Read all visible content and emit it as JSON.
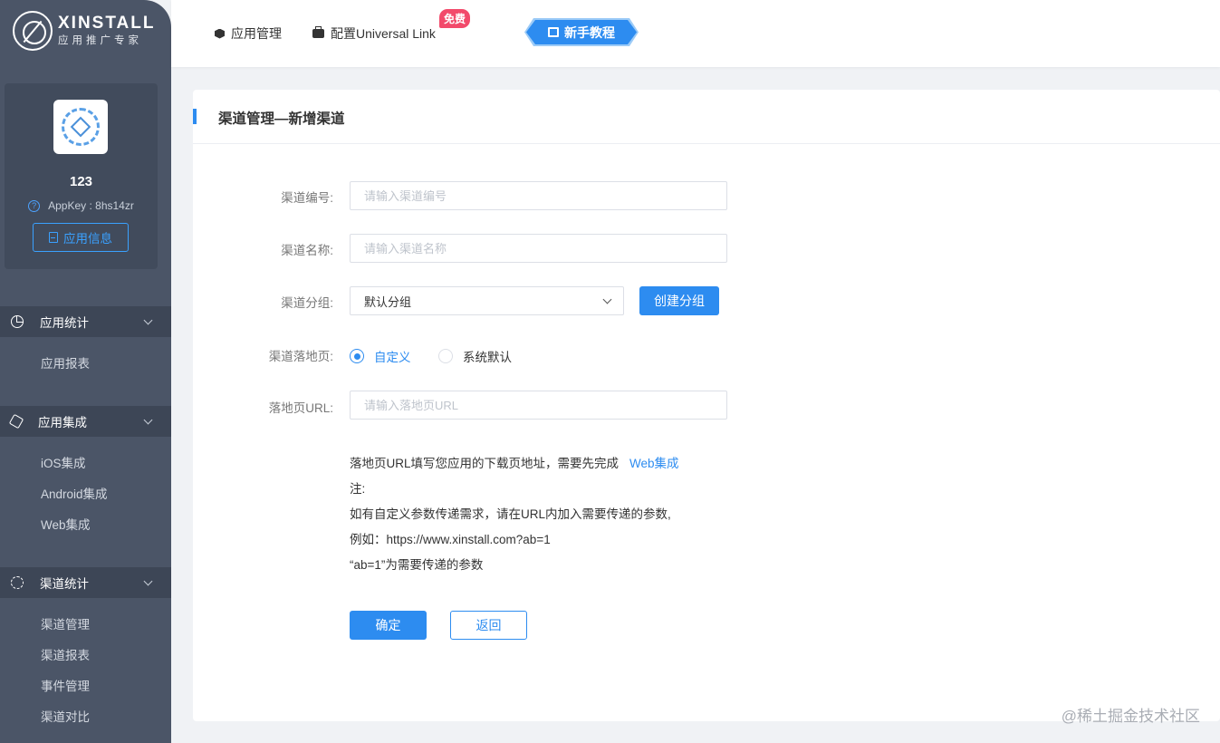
{
  "logo": {
    "title": "XINSTALL",
    "subtitle": "应用推广专家"
  },
  "app": {
    "name": "123",
    "appkey": "AppKey : 8hs14zr",
    "info_button": "应用信息"
  },
  "sidebar": {
    "groups": [
      {
        "label": "应用统计",
        "icon": "pie-chart-icon",
        "items": [
          "应用报表"
        ]
      },
      {
        "label": "应用集成",
        "icon": "cube-icon",
        "items": [
          "iOS集成",
          "Android集成",
          "Web集成"
        ]
      },
      {
        "label": "渠道统计",
        "icon": "channel-icon",
        "items": [
          "渠道管理",
          "渠道报表",
          "事件管理",
          "渠道对比"
        ]
      }
    ]
  },
  "topbar": {
    "app_manage": "应用管理",
    "universal_link": "配置Universal Link",
    "free_badge": "免费",
    "tutorial": "新手教程"
  },
  "page": {
    "title": "渠道管理—新增渠道"
  },
  "form": {
    "channel_no_label": "渠道编号:",
    "channel_no_placeholder": "请输入渠道编号",
    "channel_name_label": "渠道名称:",
    "channel_name_placeholder": "请输入渠道名称",
    "group_label": "渠道分组:",
    "group_value": "默认分组",
    "create_group": "创建分组",
    "landing_label": "渠道落地页:",
    "landing_custom": "自定义",
    "landing_default": "系统默认",
    "url_label": "落地页URL:",
    "url_placeholder": "请输入落地页URL",
    "notes": {
      "line1": "落地页URL填写您应用的下载页地址，需要先完成",
      "line1_link": "Web集成",
      "line2": "注:",
      "line3": "如有自定义参数传递需求，请在URL内加入需要传递的参数,",
      "line4": "例如：https://www.xinstall.com?ab=1",
      "line5": "“ab=1”为需要传递的参数"
    },
    "confirm": "确定",
    "back": "返回"
  },
  "watermark": "@稀土掘金技术社区",
  "colors": {
    "primary": "#2d8cf0",
    "sidebar": "#4b5567",
    "badge": "#f24a6b"
  }
}
